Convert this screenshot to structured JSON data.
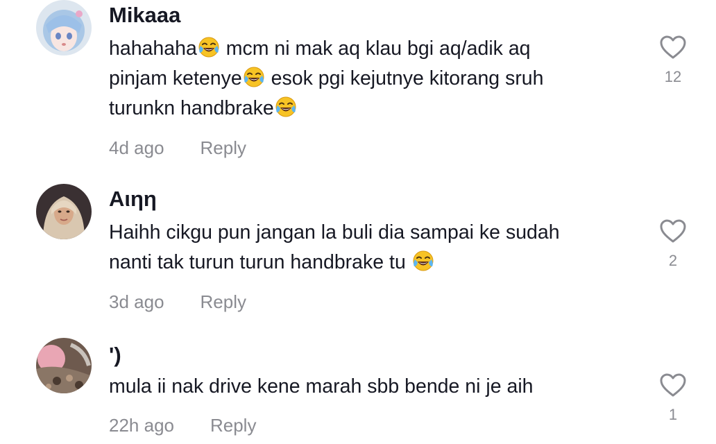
{
  "comments": [
    {
      "username": "Mikaaa",
      "lines": [
        [
          "hahahaha",
          "emoji",
          " mcm ni mak aq klau bgi aq/adik aq"
        ],
        [
          "pinjam ketenye",
          "emoji",
          " esok pgi kejutnye kitorang sruh"
        ],
        [
          "turunkn handbrake",
          "emoji",
          ""
        ]
      ],
      "time": "4d ago",
      "reply": "Reply",
      "likes": "12"
    },
    {
      "username": "Aιηη",
      "lines": [
        [
          "Haihh cikgu pun jangan la buli dia sampai ke sudah",
          "",
          ""
        ],
        [
          "nanti tak turun turun handbrake tu ",
          "emoji",
          ""
        ]
      ],
      "time": "3d ago",
      "reply": "Reply",
      "likes": "2"
    },
    {
      "username": "')",
      "lines": [
        [
          "mula ii nak drive kene marah sbb bende ni je aih",
          "",
          ""
        ]
      ],
      "time": "22h ago",
      "reply": "Reply",
      "likes": "1"
    }
  ],
  "icons": {
    "like": "heart-outline-icon",
    "emoji": "face-with-tears-of-joy-icon"
  },
  "colors": {
    "text": "#161823",
    "secondary": "#8a8b91",
    "emoji_face": "#f7c325"
  }
}
